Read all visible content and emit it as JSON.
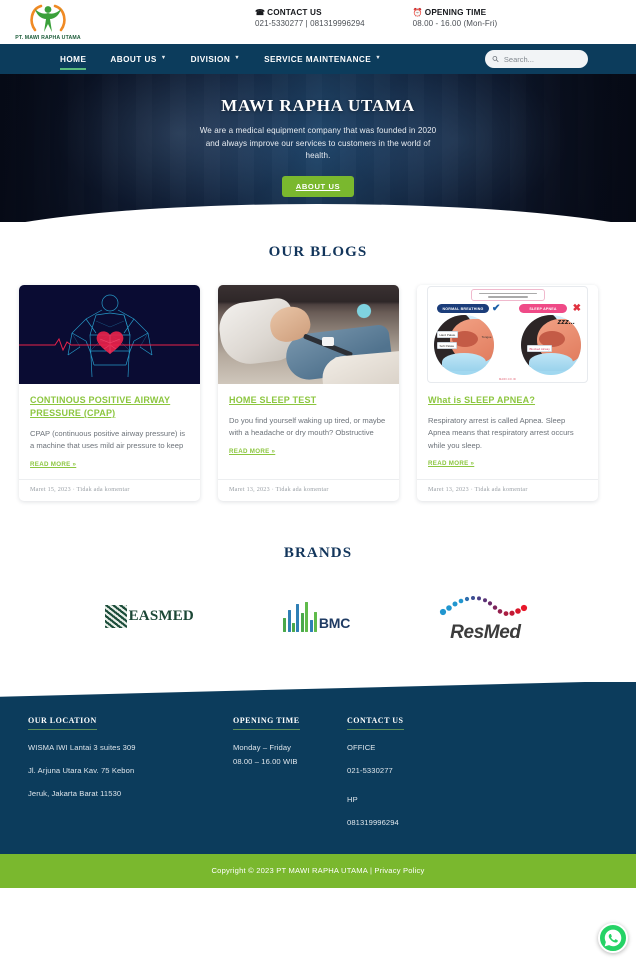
{
  "topbar": {
    "logo_text": "PT. MAWI RAPHA UTAMA",
    "contact": {
      "icon": "phone-icon",
      "label": "CONTACT US",
      "value": "021-5330277 | 081319996294"
    },
    "opening": {
      "icon": "clock-icon",
      "label": "OPENING TIME",
      "value": "08.00 - 16.00 (Mon-Fri)"
    }
  },
  "nav": {
    "items": [
      {
        "label": "HOME",
        "has_caret": false,
        "active": true
      },
      {
        "label": "ABOUT US",
        "has_caret": true,
        "active": false
      },
      {
        "label": "DIVISION",
        "has_caret": true,
        "active": false
      },
      {
        "label": "SERVICE MAINTENANCE",
        "has_caret": true,
        "active": false
      }
    ],
    "search": {
      "placeholder": "Search...",
      "value": "",
      "icon": "search-icon"
    }
  },
  "hero": {
    "title": "MAWI RAPHA UTAMA",
    "subtitle": "We are a medical equipment company that was founded in 2020 and always improve our services to customers in the world of health.",
    "button_label": "ABOUT US"
  },
  "blogs": {
    "heading": "OUR BLOGS",
    "cards": [
      {
        "image": "heart-wireframe-image",
        "title": "CONTINOUS POSITIVE AIRWAY PRESSURE (CPAP)",
        "excerpt": "CPAP (continuous positive airway pressure) is a machine that uses mild air pressure to keep",
        "read_more": "READ MORE »",
        "date": "Maret 15, 2023",
        "comments": "Tidak ada komentar",
        "meta_sep": "·"
      },
      {
        "image": "sleep-test-photo",
        "title": "HOME SLEEP TEST",
        "excerpt": "Do you find yourself waking up tired, or maybe with a headache or dry mouth? Obstructive",
        "read_more": "READ MORE »",
        "date": "Maret 13, 2023",
        "comments": "Tidak ada komentar",
        "meta_sep": "·"
      },
      {
        "image": "sleep-apnea-infographic",
        "title": "What is SLEEP APNEA?",
        "excerpt": "Respiratory arrest is called Apnea. Sleep Apnea means that respiratory arrest occurs while you sleep.",
        "read_more": "READ MORE »",
        "date": "Maret 13, 2023",
        "comments": "Tidak ada komentar",
        "meta_sep": "·"
      }
    ],
    "apnea_labels": {
      "normal": "NORMAL BREATHING",
      "apnea": "SLEEP APNEA",
      "hard_palate": "Hard Palate",
      "soft_palate": "Soft Palate",
      "tongue": "Tongue",
      "blocked": "Blocked Airway",
      "zzz": "zzz...",
      "credit": "MAWI.CO.ID"
    }
  },
  "brands": {
    "heading": "BRANDS",
    "items": [
      {
        "name": "EASMED",
        "logo": "easmed-logo"
      },
      {
        "name": "BMC",
        "logo": "bmc-logo"
      },
      {
        "name": "ResMed",
        "logo": "resmed-logo"
      }
    ]
  },
  "footer": {
    "columns": [
      {
        "heading": "OUR LOCATION",
        "lines": [
          "WISMA IWI Lantai 3 suites 309",
          "Jl. Arjuna Utara Kav. 75 Kebon",
          "Jeruk, Jakarta Barat 11530"
        ]
      },
      {
        "heading": "OPENING TIME",
        "lines": [
          "Monday – Friday",
          "08.00 – 16.00 WIB"
        ]
      },
      {
        "heading": "CONTACT US",
        "lines": [
          "OFFICE",
          "021-5330277",
          "HP",
          "081319996294"
        ]
      }
    ],
    "copyright": "Copyright © 2023 PT MAWI RAPHA UTAMA | Privacy Policy",
    "whatsapp_icon": "whatsapp-icon"
  },
  "colors": {
    "navy": "#0c3c5c",
    "green": "#7ab82e",
    "title_green": "#8cc63f",
    "heading_navy": "#12355b",
    "clock_red": "#e0452b"
  }
}
